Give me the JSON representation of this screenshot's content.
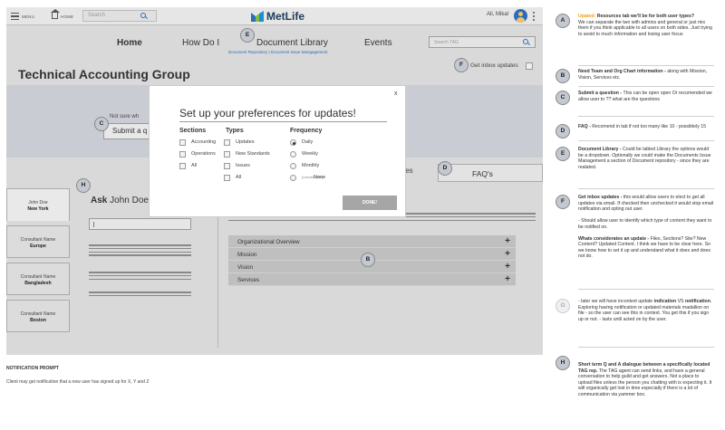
{
  "topbar": {
    "menu_label": "MENU",
    "home_label": "HOME",
    "search_placeholder": "Search",
    "logo_text": "MetLife",
    "user_name": "Ali, Mikal"
  },
  "nav": {
    "items": [
      "Home",
      "How Do I",
      "Document Library",
      "Events"
    ],
    "doc_sub": "Document Repository  |  Document Issue Mangagement",
    "search_placeholder": "Search TAG"
  },
  "page": {
    "group_title": "Technical Accounting Group",
    "inbox_label": "Get inbox updates",
    "banner_hint": "Not sure wh",
    "banner_button": "Submit a q",
    "tab_tail": "tes",
    "faq_tab": "FAQ's",
    "ask_prefix": "Ask",
    "ask_name": "John Doe",
    "people": [
      {
        "role": "John Doe",
        "name": "New York"
      },
      {
        "role": "Consultant Name",
        "name": "Europe"
      },
      {
        "role": "Consultant Name",
        "name": "Bangladesh"
      },
      {
        "role": "Consultant Name",
        "name": "Boston"
      }
    ],
    "accordion": [
      "Organizational Overview",
      "Mission",
      "Vision",
      "Services"
    ]
  },
  "modal": {
    "close": "x",
    "title": "Set up your preferences for updates!",
    "sections_head": "Sections",
    "sections": [
      "Accounting",
      "Operations",
      "All"
    ],
    "types_head": "Types",
    "types": [
      "Updates",
      "New Standards",
      "Issues",
      "All"
    ],
    "frequency_head": "Frequency",
    "frequency": [
      "Daily",
      "Weekly",
      "Monthly",
      "None"
    ],
    "frequency_none_note": "(Unsubscribe)",
    "frequency_selected": "Daily",
    "done": "DONE!"
  },
  "markers_on_canvas": {
    "c": "C",
    "e": "E",
    "f": "F",
    "h": "H",
    "d": "D",
    "b": "B"
  },
  "notification": {
    "title": "NOTIFICATION PROMPT",
    "body": "Client may get notification that a new user has signed up for X, Y and Z"
  },
  "notes": [
    {
      "letter": "A",
      "lead": "Upated:",
      "bold": " Resources tab we'll be for both user types?",
      "text": "We can separate the two with admins and general or just mix them if you think applicable to all users on both sides.  Just trying to avoid to much information and losing user focus"
    },
    {
      "letter": "B",
      "bold": "Need Team and Org Chart information -",
      "text": " along with Mission, Vision, Services etc."
    },
    {
      "letter": "C",
      "bold": "Submit a question -",
      "text": " This can be open open Or recomended we allow user to ?? what are the questions"
    },
    {
      "letter": "D",
      "bold": "FAQ -",
      "text": " Recomend in tab if not too many like 10 - possiblely 15"
    },
    {
      "letter": "E",
      "bold": "Document Library -",
      "text": " Could be labled Library the options would be a dropdown. Optionally we could make the Documents Issue Management a section of Document repository - since they are realated."
    },
    {
      "letter": "F",
      "bold": "Get inbox updates -",
      "text": " this would allow users to elect to get all updates via email. If checked then unchecked it would stop email notification and opting out user.",
      "text2": "- Should allow user to identify which type of content they want to be notified on.",
      "bold3": "Whats considerates an update -",
      "text3": " Files, Sections? Site? New Content? Updated Content.  I think we have to be clear here. So we know how to set it up and understand what it does and does not do."
    },
    {
      "letter": "G",
      "text_pre": "- later we will have incontext update ",
      "bold": "indication",
      "text_mid": " VS ",
      "bold2": "notification",
      "text": ".  Exploring having notification or updated materials madallion on file - so the user can see this in context.  You get this if you sign up or not. - lasts until acted on by the user."
    },
    {
      "letter": "H",
      "bold": "Short term Q and A dialogue between a specifically located TAG rep.",
      "text": " The TAG agent can send links, and have a general conversation to help guild and get answers. Not a place to upload files unless the person you chatting with is expecting it.  It will organically get lost in time especially if there is a lot of communication via yammer box."
    }
  ]
}
